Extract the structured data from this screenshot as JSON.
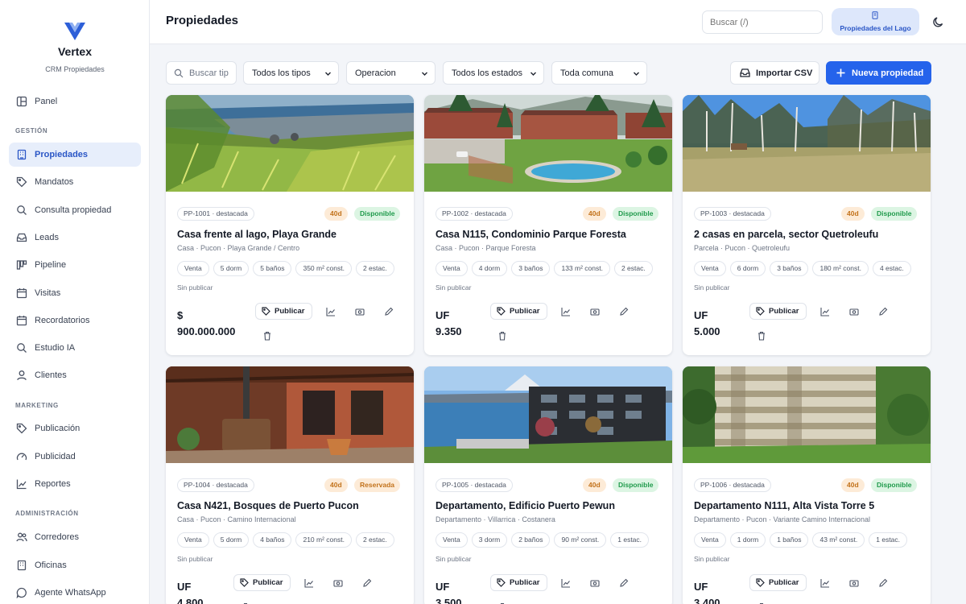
{
  "brand": {
    "name": "Vertex",
    "subtitle": "CRM Propiedades"
  },
  "sidebar": {
    "items": [
      {
        "label": "Panel",
        "icon": "dashboard-icon"
      },
      {
        "label": "Propiedades",
        "icon": "building-icon",
        "active": true
      },
      {
        "label": "Mandatos",
        "icon": "tag-icon"
      },
      {
        "label": "Consulta propiedad",
        "icon": "search-icon"
      },
      {
        "label": "Leads",
        "icon": "inbox-icon"
      },
      {
        "label": "Pipeline",
        "icon": "kanban-icon"
      },
      {
        "label": "Visitas",
        "icon": "calendar-icon"
      },
      {
        "label": "Recordatorios",
        "icon": "calendar-icon"
      },
      {
        "label": "Estudio IA",
        "icon": "search-icon"
      },
      {
        "label": "Clientes",
        "icon": "user-icon"
      },
      {
        "label": "Publicación",
        "icon": "tag-icon"
      },
      {
        "label": "Publicidad",
        "icon": "gauge-icon"
      },
      {
        "label": "Reportes",
        "icon": "chart-icon"
      },
      {
        "label": "Corredores",
        "icon": "users-icon"
      },
      {
        "label": "Oficinas",
        "icon": "building-icon"
      },
      {
        "label": "Agente WhatsApp",
        "icon": "chat-icon"
      }
    ],
    "sections": {
      "gestion": "GESTIÓN",
      "marketing": "MARKETING",
      "administracion": "ADMINISTRACIÓN"
    }
  },
  "header": {
    "title": "Propiedades",
    "search_placeholder": "Buscar (/)",
    "office": "Propiedades del Lago"
  },
  "filters": {
    "search_placeholder": "Buscar tip",
    "type": "Todos los tipos",
    "operation": "Operacion",
    "status": "Todos los estados",
    "commune": "Toda comuna",
    "import_label": "Importar CSV",
    "new_label": "Nueva propiedad"
  },
  "card_labels": {
    "unpublished": "Sin publicar",
    "publish": "Publicar"
  },
  "colors": {
    "accent": "#2563eb",
    "available": "#1f9a4b",
    "reserved": "#c2721b"
  },
  "properties": [
    {
      "code": "PP-1001 · destacada",
      "days": "40d",
      "status": "Disponible",
      "title": "Casa frente al lago, Playa Grande",
      "subtitle": "Casa · Pucon · Playa Grande / Centro",
      "chips": [
        "Venta",
        "5 dorm",
        "5 baños",
        "350 m² const.",
        "2 estac."
      ],
      "price_currency": "$",
      "price_value": "900.000.000"
    },
    {
      "code": "PP-1002 · destacada",
      "days": "40d",
      "status": "Disponible",
      "title": "Casa N115, Condominio Parque Foresta",
      "subtitle": "Casa · Pucon · Parque Foresta",
      "chips": [
        "Venta",
        "4 dorm",
        "3 baños",
        "133 m² const.",
        "2 estac."
      ],
      "price_currency": "UF",
      "price_value": "9.350"
    },
    {
      "code": "PP-1003 · destacada",
      "days": "40d",
      "status": "Disponible",
      "title": "2 casas en parcela, sector Quetroleufu",
      "subtitle": "Parcela · Pucon · Quetroleufu",
      "chips": [
        "Venta",
        "6 dorm",
        "3 baños",
        "180 m² const.",
        "4 estac."
      ],
      "price_currency": "UF",
      "price_value": "5.000"
    },
    {
      "code": "PP-1004 · destacada",
      "days": "40d",
      "status": "Reservada",
      "title": "Casa N421, Bosques de Puerto Pucon",
      "subtitle": "Casa · Pucon · Camino Internacional",
      "chips": [
        "Venta",
        "5 dorm",
        "4 baños",
        "210 m² const.",
        "2 estac."
      ],
      "price_currency": "UF",
      "price_value": "4.800"
    },
    {
      "code": "PP-1005 · destacada",
      "days": "40d",
      "status": "Disponible",
      "title": "Departamento, Edificio Puerto Pewun",
      "subtitle": "Departamento · Villarrica · Costanera",
      "chips": [
        "Venta",
        "3 dorm",
        "2 baños",
        "90 m² const.",
        "1 estac."
      ],
      "price_currency": "UF",
      "price_value": "3.500"
    },
    {
      "code": "PP-1006 · destacada",
      "days": "40d",
      "status": "Disponible",
      "title": "Departamento N111, Alta Vista Torre 5",
      "subtitle": "Departamento · Pucon · Variante Camino Internacional",
      "chips": [
        "Venta",
        "1 dorm",
        "1 baños",
        "43 m² const.",
        "1 estac."
      ],
      "price_currency": "UF",
      "price_value": "3.400"
    }
  ]
}
